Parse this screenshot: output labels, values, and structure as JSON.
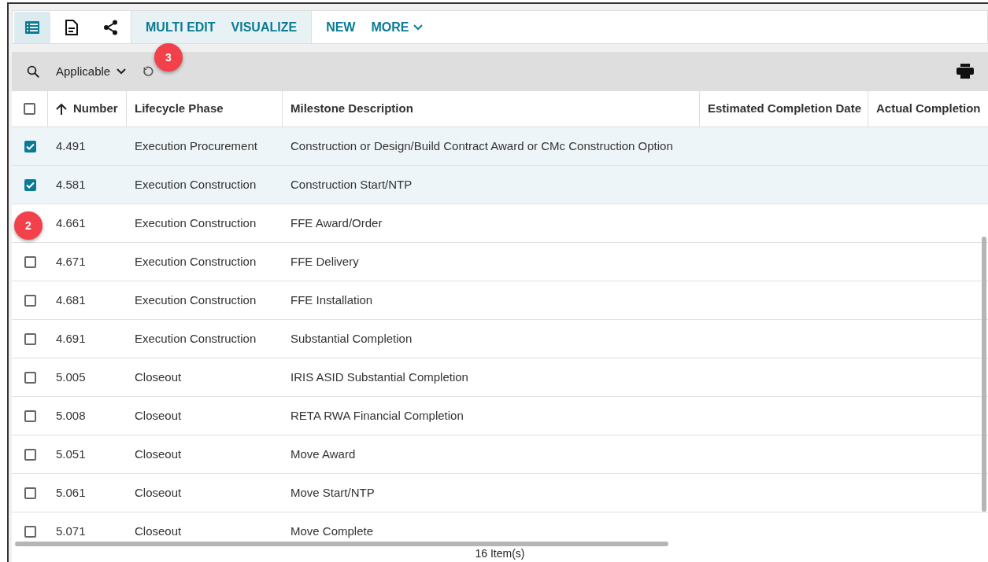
{
  "toolbar": {
    "view_buttons": [
      {
        "kind": "list",
        "selected": true
      },
      {
        "kind": "document",
        "selected": false
      },
      {
        "kind": "share",
        "selected": false
      }
    ],
    "actions": [
      "MULTI EDIT",
      "VISUALIZE"
    ],
    "menu": [
      "NEW",
      "MORE"
    ]
  },
  "filter_bar": {
    "filter": "Applicable"
  },
  "callouts": [
    {
      "number": "3",
      "kind": "toolbar"
    },
    {
      "number": "2",
      "kind": "row"
    }
  ],
  "table": {
    "select_all": {
      "checked": false
    },
    "columns": [
      "Number",
      "Lifecycle Phase",
      "Milestone Description",
      "Estimated Completion Date",
      "Actual Completion"
    ],
    "rows": [
      {
        "checked": true,
        "cells": [
          "4.491",
          "Execution Procurement",
          "Construction or Design/Build Contract Award or CMc Construction Option"
        ]
      },
      {
        "checked": true,
        "cells": [
          "4.581",
          "Execution Construction",
          "Construction Start/NTP"
        ]
      },
      {
        "cells": [
          "4.661",
          "Execution Construction",
          "FFE Award/Order"
        ]
      },
      {
        "checked": false,
        "cells": [
          "4.671",
          "Execution Construction",
          "FFE Delivery"
        ]
      },
      {
        "checked": false,
        "cells": [
          "4.681",
          "Execution Construction",
          "FFE Installation"
        ]
      },
      {
        "checked": false,
        "cells": [
          "4.691",
          "Execution Construction",
          "Substantial Completion"
        ]
      },
      {
        "checked": false,
        "cells": [
          "5.005",
          "Closeout",
          "IRIS ASID Substantial Completion"
        ]
      },
      {
        "checked": false,
        "cells": [
          "5.008",
          "Closeout",
          "RETA RWA Financial Completion"
        ]
      },
      {
        "checked": false,
        "cells": [
          "5.051",
          "Closeout",
          "Move Award"
        ]
      },
      {
        "checked": false,
        "cells": [
          "5.061",
          "Closeout",
          "Move Start/NTP"
        ]
      },
      {
        "checked": false,
        "cells": [
          "5.071",
          "Closeout",
          "Move Complete"
        ]
      }
    ]
  },
  "status_bar": {
    "count": "16 Item(s)"
  }
}
